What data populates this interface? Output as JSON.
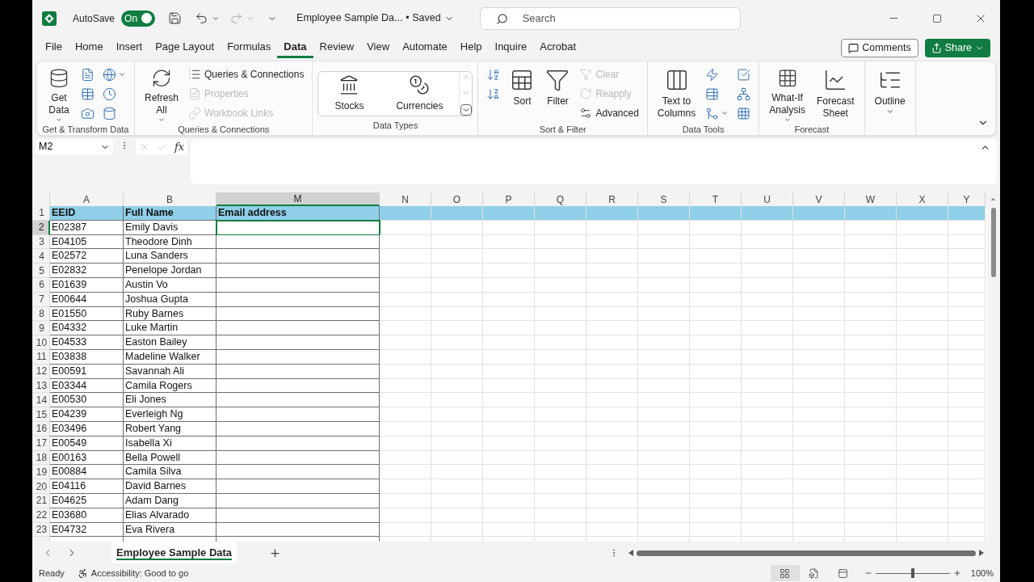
{
  "title_bar": {
    "autosave": {
      "label": "AutoSave",
      "on": true,
      "state_label": "On"
    },
    "document_title": "Employee Sample Da...",
    "save_status": "• Saved",
    "search": {
      "placeholder": "Search"
    }
  },
  "menu_tabs": [
    {
      "label": "File",
      "selected": false
    },
    {
      "label": "Home",
      "selected": false
    },
    {
      "label": "Insert",
      "selected": false
    },
    {
      "label": "Page Layout",
      "selected": false
    },
    {
      "label": "Formulas",
      "selected": false
    },
    {
      "label": "Data",
      "selected": true
    },
    {
      "label": "Review",
      "selected": false
    },
    {
      "label": "View",
      "selected": false
    },
    {
      "label": "Automate",
      "selected": false
    },
    {
      "label": "Help",
      "selected": false
    },
    {
      "label": "Inquire",
      "selected": false
    },
    {
      "label": "Acrobat",
      "selected": false
    }
  ],
  "comments_button": "Comments",
  "share_button": "Share",
  "ribbon": {
    "groups": [
      {
        "label": "Get & Transform Data",
        "items": [
          {
            "kind": "large",
            "lines": [
              "Get",
              "Data"
            ],
            "has_menu": true
          },
          {
            "kind": "icon",
            "has_menu": false
          },
          {
            "kind": "icon",
            "has_menu": false
          },
          {
            "kind": "icon",
            "has_menu": false
          },
          {
            "kind": "icon",
            "has_menu": true
          },
          {
            "kind": "icon",
            "has_menu": false
          },
          {
            "kind": "icon",
            "has_menu": false
          }
        ]
      },
      {
        "label": "Queries & Connections",
        "items": [
          {
            "kind": "large",
            "lines": [
              "Refresh",
              "All"
            ],
            "has_menu": true
          },
          {
            "kind": "small",
            "label": "Queries & Connections",
            "disabled": false
          },
          {
            "kind": "small",
            "label": "Properties",
            "disabled": true
          },
          {
            "kind": "small",
            "label": "Workbook Links",
            "disabled": true
          }
        ]
      },
      {
        "label": "Data Types",
        "items": [
          {
            "kind": "gallery",
            "options": [
              "Stocks",
              "Currencies"
            ]
          }
        ]
      },
      {
        "label": "Sort & Filter",
        "items": [
          {
            "kind": "icon",
            "has_menu": false
          },
          {
            "kind": "icon",
            "has_menu": false
          },
          {
            "kind": "large",
            "lines": [
              "Sort"
            ],
            "has_menu": false
          },
          {
            "kind": "large",
            "lines": [
              "Filter"
            ],
            "has_menu": false
          },
          {
            "kind": "small",
            "label": "Clear",
            "disabled": true
          },
          {
            "kind": "small",
            "label": "Reapply",
            "disabled": true
          },
          {
            "kind": "small",
            "label": "Advanced",
            "disabled": false
          }
        ]
      },
      {
        "label": "Data Tools",
        "items": [
          {
            "kind": "large",
            "lines": [
              "Text to",
              "Columns"
            ],
            "has_menu": false
          },
          {
            "kind": "icon",
            "has_menu": false
          },
          {
            "kind": "icon",
            "has_menu": false
          },
          {
            "kind": "icon",
            "has_menu": true
          },
          {
            "kind": "icon",
            "has_menu": false
          },
          {
            "kind": "icon",
            "has_menu": false
          },
          {
            "kind": "icon",
            "has_menu": false
          }
        ]
      },
      {
        "label": "Forecast",
        "items": [
          {
            "kind": "large",
            "lines": [
              "What-If",
              "Analysis"
            ],
            "has_menu": true
          },
          {
            "kind": "large",
            "lines": [
              "Forecast",
              "Sheet"
            ],
            "has_menu": false
          }
        ]
      },
      {
        "items": [
          {
            "kind": "large",
            "lines": [
              "Outline"
            ],
            "has_menu": true
          }
        ]
      }
    ]
  },
  "formula_bar": {
    "name_box": "M2",
    "fx": "fx"
  },
  "sheet": {
    "columns": [
      {
        "label": "A",
        "selected": false
      },
      {
        "label": "B",
        "selected": false
      },
      {
        "label": "M",
        "selected": true
      },
      {
        "label": "N",
        "selected": false
      },
      {
        "label": "O",
        "selected": false
      },
      {
        "label": "P",
        "selected": false
      },
      {
        "label": "Q",
        "selected": false
      },
      {
        "label": "R",
        "selected": false
      },
      {
        "label": "S",
        "selected": false
      },
      {
        "label": "T",
        "selected": false
      },
      {
        "label": "U",
        "selected": false
      },
      {
        "label": "V",
        "selected": false
      },
      {
        "label": "W",
        "selected": false
      },
      {
        "label": "X",
        "selected": false
      },
      {
        "label": "Y",
        "selected": false
      }
    ],
    "rows": [
      {
        "number": "1",
        "selected": false,
        "kind": "header",
        "cells": [
          {
            "value": "EEID",
            "selected": false
          },
          {
            "value": "Full Name",
            "selected": false
          },
          {
            "value": "Email address",
            "selected": false
          }
        ]
      },
      {
        "number": "2",
        "selected": true,
        "kind": "data",
        "cells": [
          {
            "value": "E02387",
            "selected": false
          },
          {
            "value": "Emily Davis",
            "selected": false
          },
          {
            "selected": true
          }
        ]
      },
      {
        "number": "3",
        "selected": false,
        "kind": "data",
        "cells": [
          {
            "value": "E04105",
            "selected": false
          },
          {
            "value": "Theodore Dinh",
            "selected": false
          },
          {
            "selected": false
          }
        ]
      },
      {
        "number": "4",
        "selected": false,
        "kind": "data",
        "cells": [
          {
            "value": "E02572",
            "selected": false
          },
          {
            "value": "Luna Sanders",
            "selected": false
          },
          {
            "selected": false
          }
        ]
      },
      {
        "number": "5",
        "selected": false,
        "kind": "data",
        "cells": [
          {
            "value": "E02832",
            "selected": false
          },
          {
            "value": "Penelope Jordan",
            "selected": false
          },
          {
            "selected": false
          }
        ]
      },
      {
        "number": "6",
        "selected": false,
        "kind": "data",
        "cells": [
          {
            "value": "E01639",
            "selected": false
          },
          {
            "value": "Austin Vo",
            "selected": false
          },
          {
            "selected": false
          }
        ]
      },
      {
        "number": "7",
        "selected": false,
        "kind": "data",
        "cells": [
          {
            "value": "E00644",
            "selected": false
          },
          {
            "value": "Joshua Gupta",
            "selected": false
          },
          {
            "selected": false
          }
        ]
      },
      {
        "number": "8",
        "selected": false,
        "kind": "data",
        "cells": [
          {
            "value": "E01550",
            "selected": false
          },
          {
            "value": "Ruby Barnes",
            "selected": false
          },
          {
            "selected": false
          }
        ]
      },
      {
        "number": "9",
        "selected": false,
        "kind": "data",
        "cells": [
          {
            "value": "E04332",
            "selected": false
          },
          {
            "value": "Luke Martin",
            "selected": false
          },
          {
            "selected": false
          }
        ]
      },
      {
        "number": "10",
        "selected": false,
        "kind": "data",
        "cells": [
          {
            "value": "E04533",
            "selected": false
          },
          {
            "value": "Easton Bailey",
            "selected": false
          },
          {
            "selected": false
          }
        ]
      },
      {
        "number": "11",
        "selected": false,
        "kind": "data",
        "cells": [
          {
            "value": "E03838",
            "selected": false
          },
          {
            "value": "Madeline Walker",
            "selected": false
          },
          {
            "selected": false
          }
        ]
      },
      {
        "number": "12",
        "selected": false,
        "kind": "data",
        "cells": [
          {
            "value": "E00591",
            "selected": false
          },
          {
            "value": "Savannah Ali",
            "selected": false
          },
          {
            "selected": false
          }
        ]
      },
      {
        "number": "13",
        "selected": false,
        "kind": "data",
        "cells": [
          {
            "value": "E03344",
            "selected": false
          },
          {
            "value": "Camila Rogers",
            "selected": false
          },
          {
            "selected": false
          }
        ]
      },
      {
        "number": "14",
        "selected": false,
        "kind": "data",
        "cells": [
          {
            "value": "E00530",
            "selected": false
          },
          {
            "value": "Eli Jones",
            "selected": false
          },
          {
            "selected": false
          }
        ]
      },
      {
        "number": "15",
        "selected": false,
        "kind": "data",
        "cells": [
          {
            "value": "E04239",
            "selected": false
          },
          {
            "value": "Everleigh Ng",
            "selected": false
          },
          {
            "selected": false
          }
        ]
      },
      {
        "number": "16",
        "selected": false,
        "kind": "data",
        "cells": [
          {
            "value": "E03496",
            "selected": false
          },
          {
            "value": "Robert Yang",
            "selected": false
          },
          {
            "selected": false
          }
        ]
      },
      {
        "number": "17",
        "selected": false,
        "kind": "data",
        "cells": [
          {
            "value": "E00549",
            "selected": false
          },
          {
            "value": "Isabella Xi",
            "selected": false
          },
          {
            "selected": false
          }
        ]
      },
      {
        "number": "18",
        "selected": false,
        "kind": "data",
        "cells": [
          {
            "value": "E00163",
            "selected": false
          },
          {
            "value": "Bella Powell",
            "selected": false
          },
          {
            "selected": false
          }
        ]
      },
      {
        "number": "19",
        "selected": false,
        "kind": "data",
        "cells": [
          {
            "value": "E00884",
            "selected": false
          },
          {
            "value": "Camila Silva",
            "selected": false
          },
          {
            "selected": false
          }
        ]
      },
      {
        "number": "20",
        "selected": false,
        "kind": "data",
        "cells": [
          {
            "value": "E04116",
            "selected": false
          },
          {
            "value": "David Barnes",
            "selected": false
          },
          {
            "selected": false
          }
        ]
      },
      {
        "number": "21",
        "selected": false,
        "kind": "data",
        "cells": [
          {
            "value": "E04625",
            "selected": false
          },
          {
            "value": "Adam Dang",
            "selected": false
          },
          {
            "selected": false
          }
        ]
      },
      {
        "number": "22",
        "selected": false,
        "kind": "data",
        "cells": [
          {
            "value": "E03680",
            "selected": false
          },
          {
            "value": "Elias Alvarado",
            "selected": false
          },
          {
            "selected": false
          }
        ]
      },
      {
        "number": "23",
        "selected": false,
        "kind": "data",
        "cells": [
          {
            "value": "E04732",
            "selected": false
          },
          {
            "value": "Eva Rivera",
            "selected": false
          },
          {
            "selected": false
          }
        ]
      }
    ]
  },
  "sheet_tabs": [
    {
      "label": "Employee Sample Data",
      "selected": true
    }
  ],
  "status_bar": {
    "status": "Ready",
    "accessibility": "Accessibility: Good to go",
    "views": [
      {
        "selected": true
      },
      {
        "selected": false
      },
      {
        "selected": false
      }
    ],
    "zoom": {
      "level": 0.5,
      "label": "100%"
    }
  }
}
